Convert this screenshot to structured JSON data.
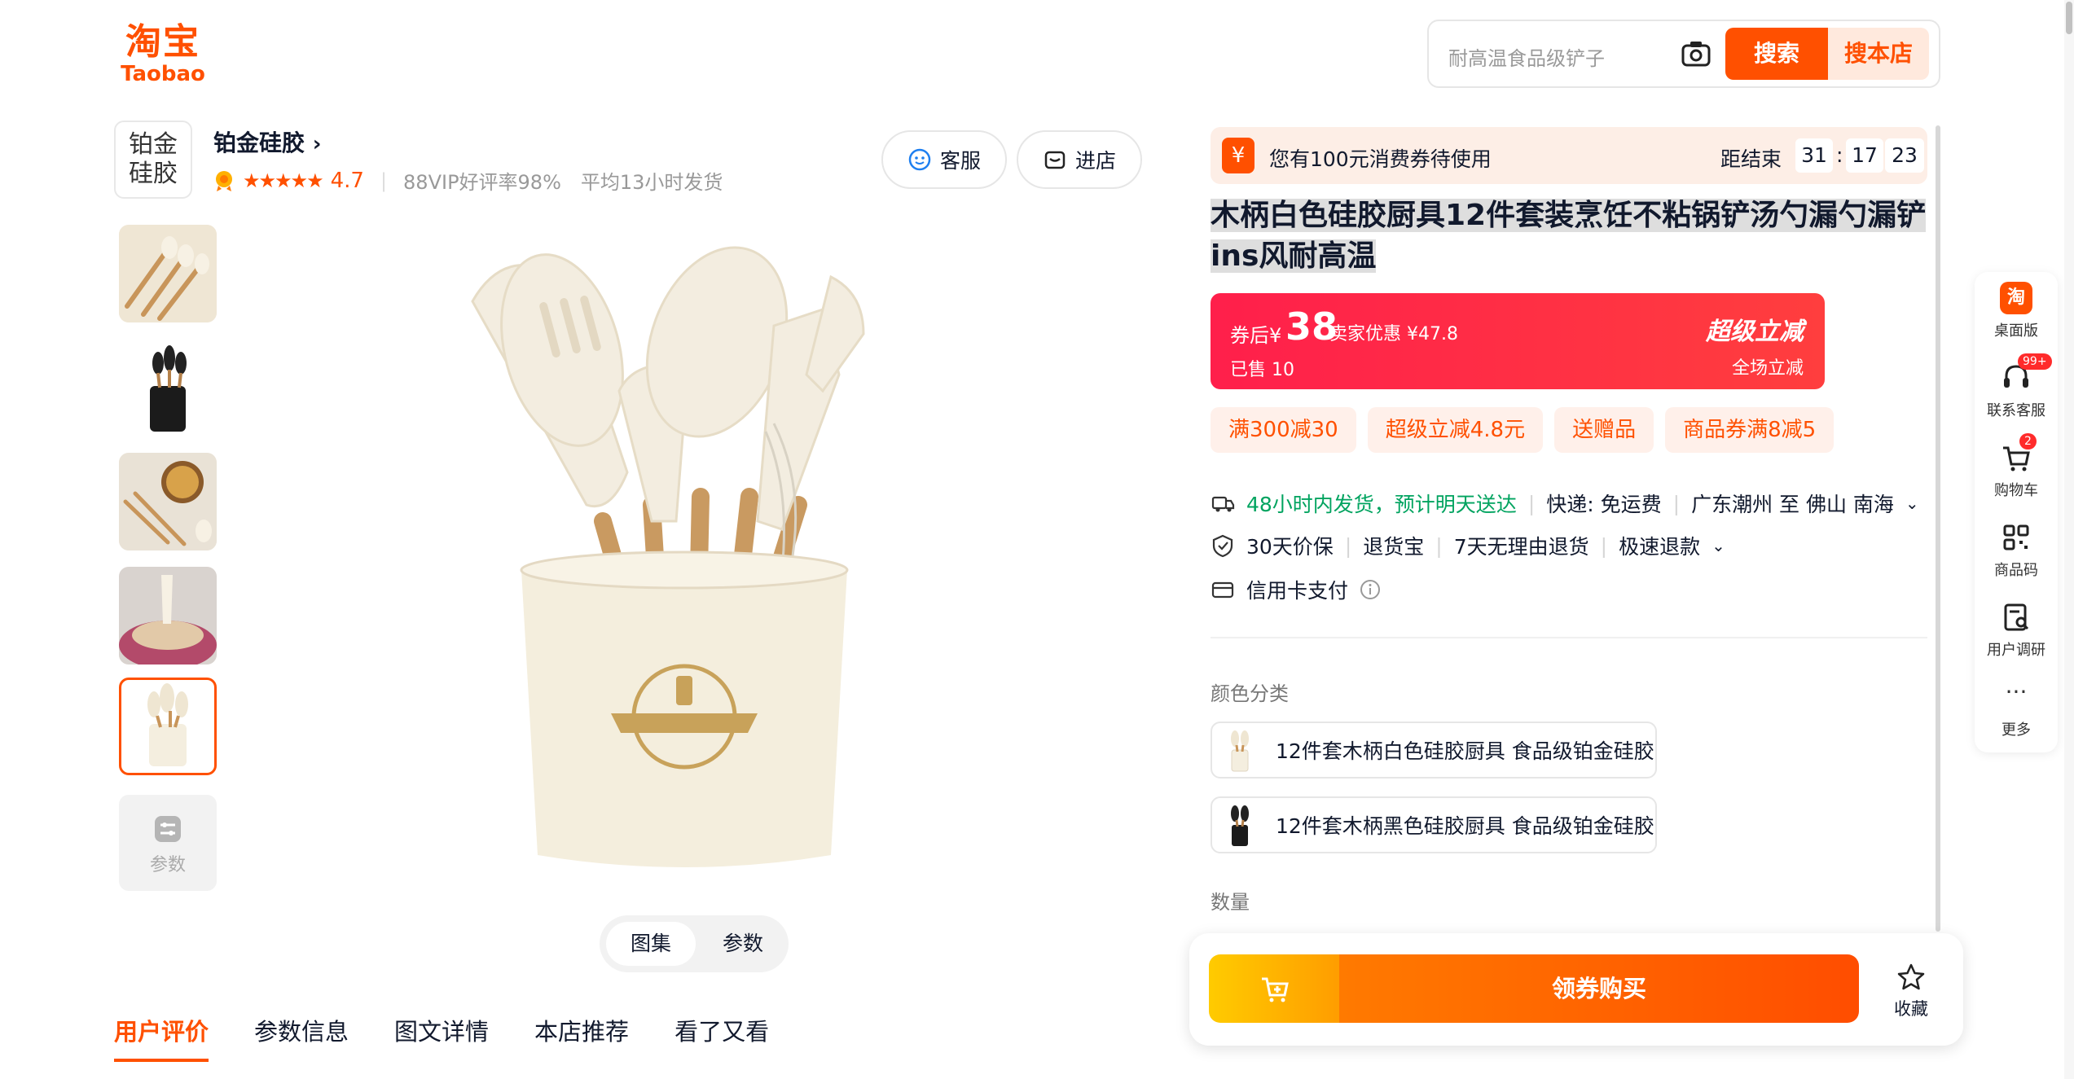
{
  "header": {
    "logo_cn": "淘宝",
    "logo_en": "Taobao",
    "search_placeholder": "耐高温食品级铲子",
    "search_button": "搜索",
    "store_search_button": "搜本店"
  },
  "shop": {
    "logo_text": "铂金硅胶",
    "name": "铂金硅胶",
    "rating": "4.7",
    "vip_rate": "88VIP好评率98%",
    "avg_ship": "平均13小时发货",
    "service_button": "客服",
    "enter_store_button": "进店"
  },
  "gallery": {
    "params_thumb_label": "参数",
    "toggle_gallery": "图集",
    "toggle_params": "参数"
  },
  "tabs": [
    "用户评价",
    "参数信息",
    "图文详情",
    "本店推荐",
    "看了又看"
  ],
  "coupon_bar": {
    "text": "您有100元消费券待使用",
    "countdown_label": "距结束",
    "hh": "31",
    "mm": "17",
    "ss": "23"
  },
  "product": {
    "title": "木柄白色硅胶厨具12件套装烹饪不粘锅铲汤勺漏勺漏铲ins风耐高温"
  },
  "price": {
    "after_coupon_label": "券后¥",
    "after_coupon_value": "38",
    "seller_discount": "卖家优惠 ¥47.8",
    "sold": "已售 10",
    "super_discount": "超级立减",
    "all_store": "全场立减"
  },
  "promos": [
    "满300减30",
    "超级立减4.8元",
    "送赠品",
    "商品券满8减5"
  ],
  "services": {
    "ship_fast": "48小时内发货，预计明天送达",
    "delivery": "快递: 免运费",
    "route": "广东潮州 至 佛山 南海",
    "guarantees": [
      "30天价保",
      "退货宝",
      "7天无理由退货",
      "极速退款"
    ],
    "payment": "信用卡支付"
  },
  "sku": {
    "color_label": "颜色分类",
    "options": [
      "12件套木柄白色硅胶厨具 食品级铂金硅胶",
      "12件套木柄黑色硅胶厨具 食品级铂金硅胶"
    ],
    "qty_label": "数量"
  },
  "buybar": {
    "buy_button": "领券购买",
    "favorite": "收藏"
  },
  "sidebar": {
    "items": [
      {
        "label": "桌面版",
        "badge": ""
      },
      {
        "label": "联系客服",
        "badge": "99+"
      },
      {
        "label": "购物车",
        "badge": "2"
      },
      {
        "label": "商品码",
        "badge": ""
      },
      {
        "label": "用户调研",
        "badge": ""
      },
      {
        "label": "更多",
        "badge": ""
      }
    ]
  },
  "colors": {
    "brand": "#ff5000",
    "price_red": "#ff2b4b",
    "green": "#00a35f"
  }
}
